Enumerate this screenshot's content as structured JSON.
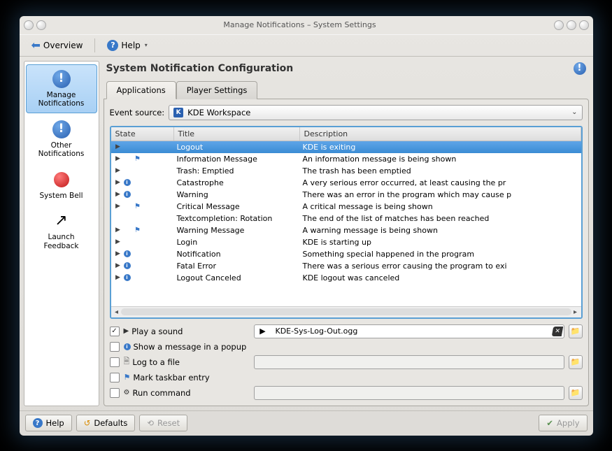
{
  "window": {
    "title": "Manage Notifications – System Settings"
  },
  "toolbar": {
    "overview": "Overview",
    "help": "Help"
  },
  "sidebar": {
    "items": [
      {
        "label": "Manage\nNotifications",
        "icon": "bang",
        "active": true
      },
      {
        "label": "Other\nNotifications",
        "icon": "bang",
        "active": false
      },
      {
        "label": "System Bell",
        "icon": "bell",
        "active": false
      },
      {
        "label": "Launch\nFeedback",
        "icon": "rocket",
        "active": false
      }
    ]
  },
  "content": {
    "title": "System Notification Configuration",
    "tabs": [
      {
        "label": "Applications",
        "active": true
      },
      {
        "label": "Player Settings",
        "active": false
      }
    ],
    "event_source_label": "Event source:",
    "event_source_value": "KDE Workspace",
    "columns": {
      "state": "State",
      "title": "Title",
      "description": "Description"
    },
    "rows": [
      {
        "play": true,
        "info": false,
        "flag": false,
        "title": "Logout",
        "desc": "KDE is exiting",
        "selected": true
      },
      {
        "play": true,
        "info": false,
        "flag": true,
        "title": "Information Message",
        "desc": "An information message is being shown"
      },
      {
        "play": true,
        "info": false,
        "flag": false,
        "title": "Trash: Emptied",
        "desc": "The trash has been emptied"
      },
      {
        "play": true,
        "info": true,
        "flag": false,
        "title": "Catastrophe",
        "desc": "A very serious error occurred, at least causing the pr"
      },
      {
        "play": true,
        "info": true,
        "flag": false,
        "title": "Warning",
        "desc": "There was an error in the program which may cause p"
      },
      {
        "play": true,
        "info": false,
        "flag": true,
        "title": "Critical Message",
        "desc": "A critical message is being shown"
      },
      {
        "play": false,
        "info": false,
        "flag": false,
        "title": "Textcompletion: Rotation",
        "desc": "The end of the list of matches has been reached"
      },
      {
        "play": true,
        "info": false,
        "flag": true,
        "title": "Warning Message",
        "desc": "A warning message is being shown"
      },
      {
        "play": true,
        "info": false,
        "flag": false,
        "title": "Login",
        "desc": "KDE is starting up"
      },
      {
        "play": true,
        "info": true,
        "flag": false,
        "title": "Notification",
        "desc": "Something special happened in the program"
      },
      {
        "play": true,
        "info": true,
        "flag": false,
        "title": "Fatal Error",
        "desc": "There was a serious error causing the program to exi"
      },
      {
        "play": true,
        "info": true,
        "flag": false,
        "title": "Logout Canceled",
        "desc": "KDE logout was canceled"
      }
    ],
    "options": {
      "play_sound": {
        "checked": true,
        "label": "Play a sound",
        "value": "KDE-Sys-Log-Out.ogg"
      },
      "popup": {
        "checked": false,
        "label": "Show a message in a popup"
      },
      "log_file": {
        "checked": false,
        "label": "Log to a file",
        "value": ""
      },
      "mark_taskbar": {
        "checked": false,
        "label": "Mark taskbar entry"
      },
      "run_command": {
        "checked": false,
        "label": "Run command",
        "value": ""
      }
    }
  },
  "buttons": {
    "help": "Help",
    "defaults": "Defaults",
    "reset": "Reset",
    "apply": "Apply"
  }
}
